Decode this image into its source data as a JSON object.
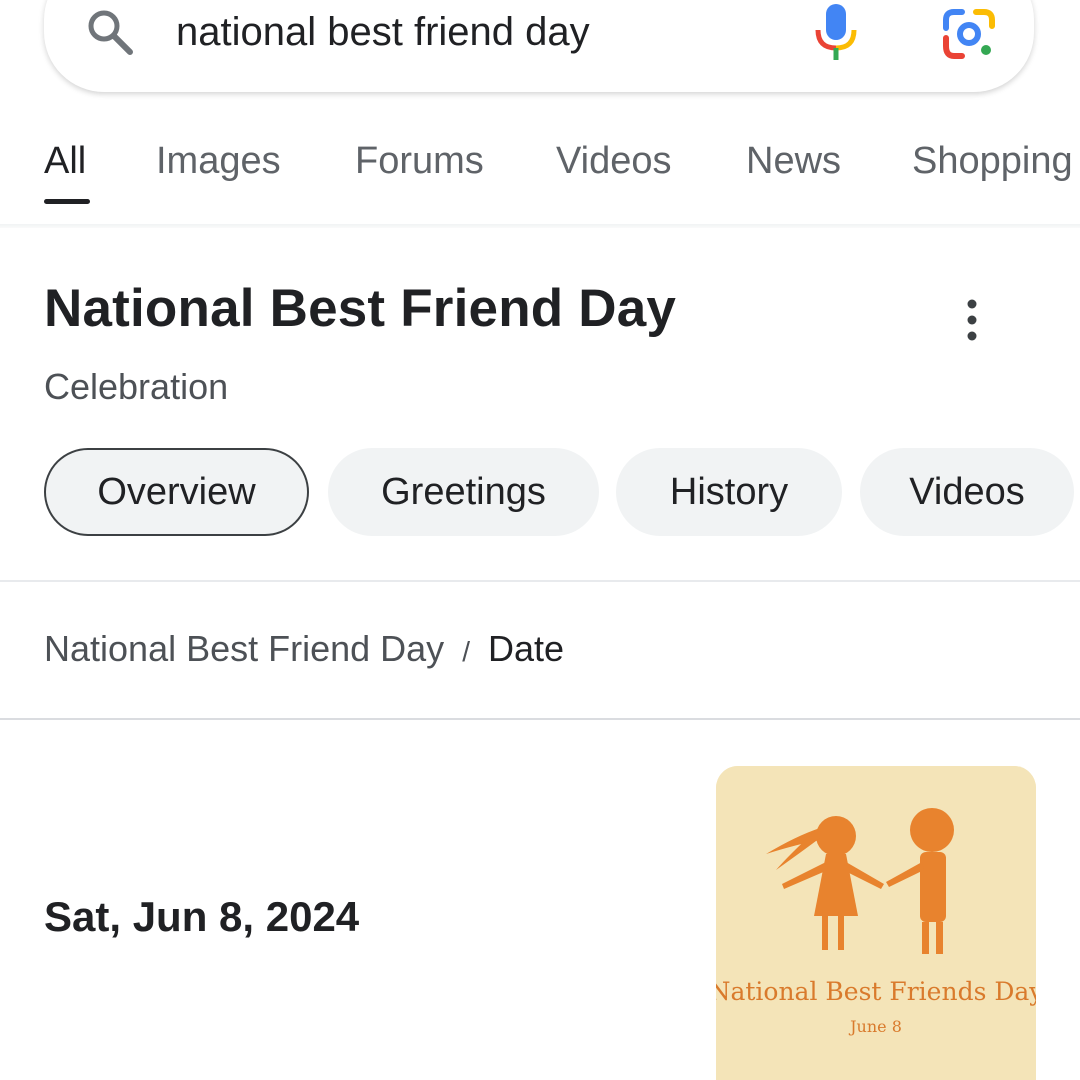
{
  "search": {
    "query": "national best friend day",
    "icon": "search-icon",
    "voice_icon": "mic-icon",
    "lens_icon": "lens-icon"
  },
  "tabs": [
    {
      "label": "All",
      "active": true
    },
    {
      "label": "Images"
    },
    {
      "label": "Forums"
    },
    {
      "label": "Videos"
    },
    {
      "label": "News"
    },
    {
      "label": "Shopping"
    }
  ],
  "knowledge_panel": {
    "title": "National Best Friend Day",
    "subtitle": "Celebration",
    "more_icon": "more-vert-icon"
  },
  "chips": [
    {
      "label": "Overview",
      "selected": true
    },
    {
      "label": "Greetings"
    },
    {
      "label": "History"
    },
    {
      "label": "Videos"
    }
  ],
  "breadcrumb": {
    "root": "National Best Friend Day",
    "separator": "/",
    "leaf": "Date"
  },
  "answer": {
    "date": "Sat, Jun 8, 2024"
  },
  "thumbnail": {
    "caption": "National Best Friends Day",
    "subcaption": "June 8"
  },
  "colors": {
    "chip_bg": "#f1f3f4",
    "text_primary": "#202124",
    "text_secondary": "#5f6368",
    "thumb_bg": "#f4e4b8",
    "figure_orange": "#e8832e"
  }
}
